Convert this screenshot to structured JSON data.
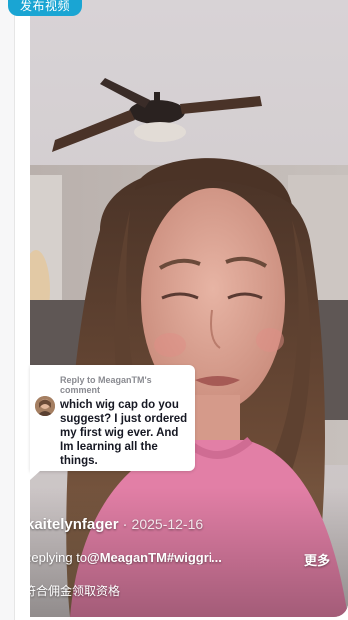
{
  "publish_tag": {
    "label": "发布视频"
  },
  "reply_bubble": {
    "header": "Reply to MeaganTM's comment",
    "text": "which wig cap do you suggest? I just ordered my first wig ever. And Im learning all the things."
  },
  "post": {
    "author": "kaitelynfager",
    "separator": "·",
    "date": "2025-12-16",
    "caption_prefix": "Replying to",
    "caption": "@MeaganTM#wiggrip#dream",
    "caption_ellipsis": "...",
    "more_label": "更多",
    "commission_text": "符合佣金领取资格"
  },
  "colors": {
    "publish_tag_bg": "#1aa5d3",
    "video_bg": "#6b5c57",
    "sweater": "#e27fa6"
  },
  "icons": {
    "ceiling_fan": "ceiling-fan-graphic",
    "avatar": "user-avatar"
  }
}
